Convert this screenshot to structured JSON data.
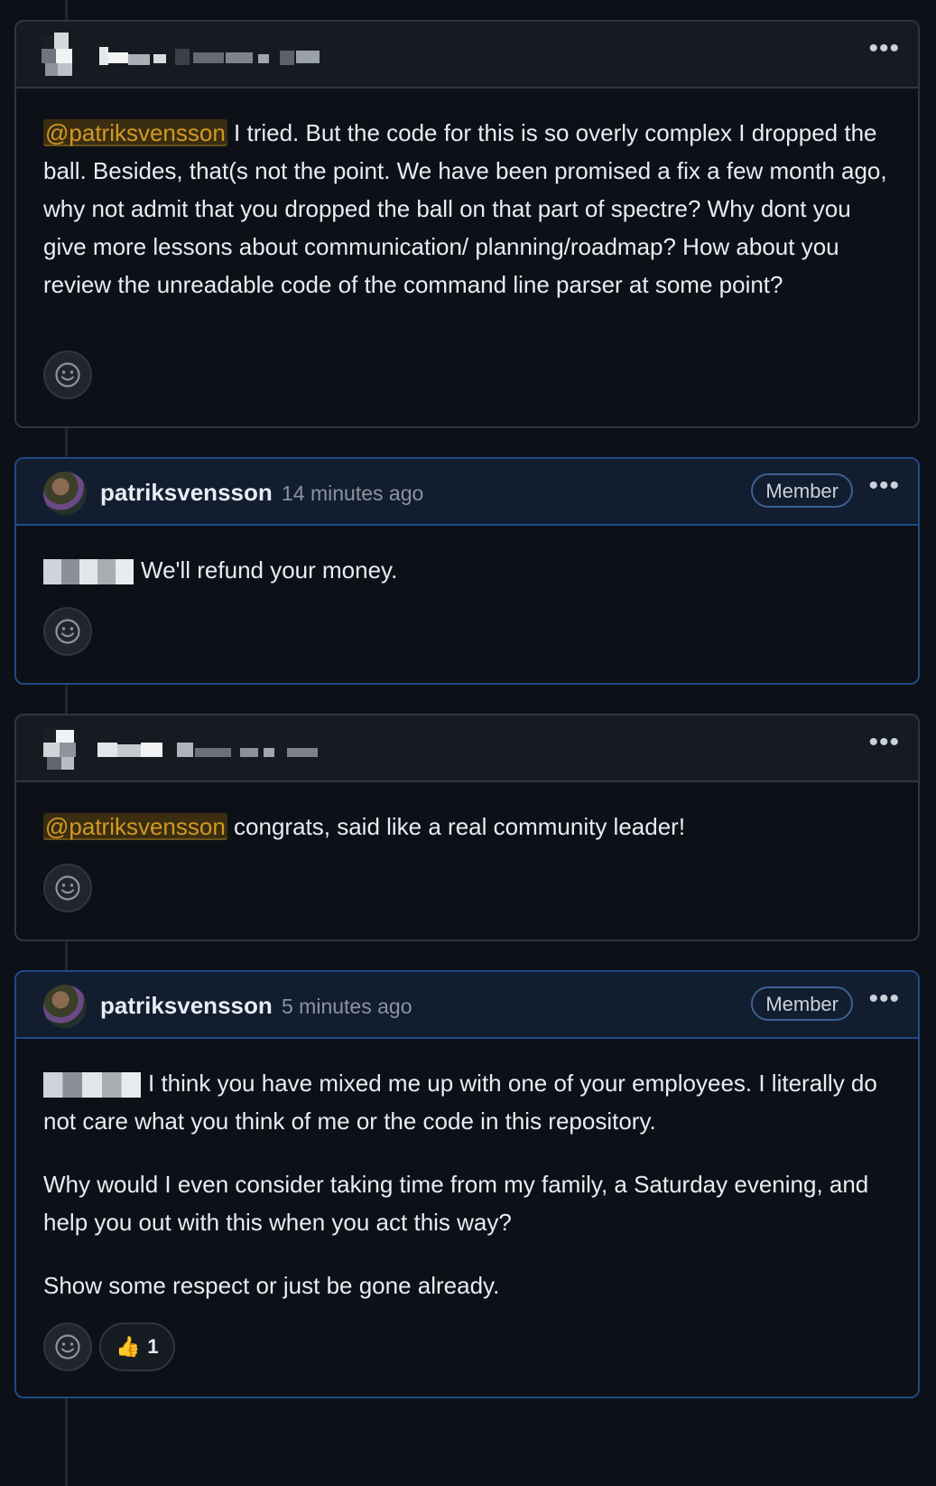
{
  "comments": [
    {
      "author": "",
      "time": "",
      "badge": "",
      "text_parts": {
        "mention": "@patriksvensson",
        "rest": " I tried. But the code for this is so overly complex I dropped the ball. Besides, that(s not the point. We have been promised a fix a few month ago, why not admit that you dropped the ball on that part of spectre? Why dont you give more lessons about communication/ planning/roadmap? How about you review the unreadable code of the command line parser at some point?"
      }
    },
    {
      "author": "patriksvensson",
      "time": "14 minutes ago",
      "badge": "Member",
      "text": "We'll refund your money."
    },
    {
      "author": "",
      "time": "",
      "badge": "",
      "text_parts": {
        "mention": "@patriksvensson",
        "rest": " congrats, said like a real community leader!"
      }
    },
    {
      "author": "patriksvensson",
      "time": "5 minutes ago",
      "badge": "Member",
      "paragraphs": [
        "I think you have mixed me up with one of your employees. I literally do not care what you think of me or the code in this repository.",
        "Why would I even consider taking time from my family, a Saturday evening, and help you out with this when you act this way?",
        "Show some respect or just be gone already."
      ],
      "reaction": {
        "emoji": "👍",
        "count": "1"
      }
    }
  ],
  "icons": {
    "add_reaction": "smiley-icon",
    "more": "kebab-horizontal-icon"
  },
  "colors": {
    "background": "#0d1117",
    "mention": "#d29922",
    "member_border": "#1f4a85"
  }
}
